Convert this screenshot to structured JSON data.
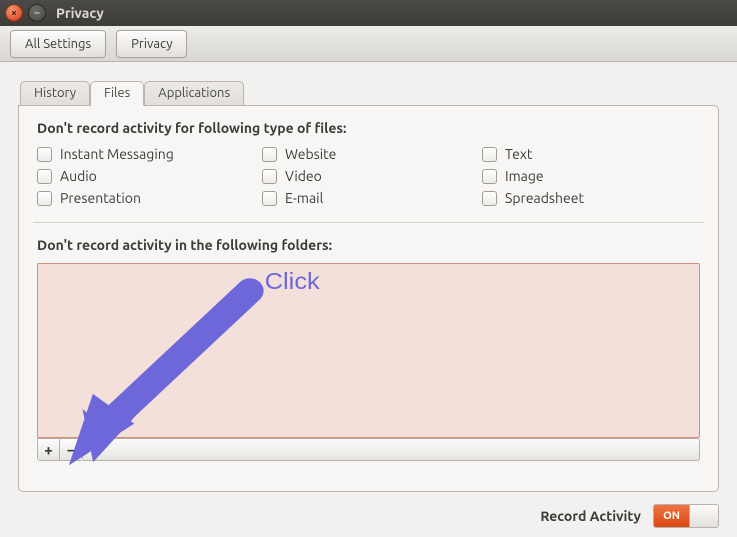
{
  "window": {
    "title": "Privacy"
  },
  "toolbar": {
    "all_settings": "All Settings",
    "crumb": "Privacy"
  },
  "tabs": {
    "history": "History",
    "files": "Files",
    "applications": "Applications",
    "active": "files"
  },
  "files_panel": {
    "types_heading": "Don't record activity for following type of files:",
    "types": [
      "Instant Messaging",
      "Website",
      "Text",
      "Audio",
      "Video",
      "Image",
      "Presentation",
      "E-mail",
      "Spreadsheet"
    ],
    "folders_heading": "Don't record activity in the following folders:",
    "folders": [],
    "add_tooltip": "+",
    "remove_tooltip": "−"
  },
  "footer": {
    "label": "Record Activity",
    "switch_on": "ON",
    "state": true
  },
  "annotation": {
    "text": "Click",
    "color": "#6e67d9"
  }
}
